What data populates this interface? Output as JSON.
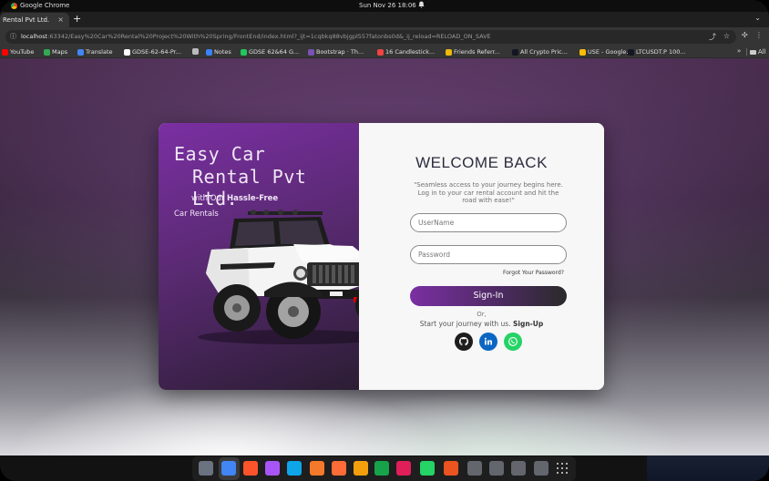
{
  "system": {
    "app_name": "Google Chrome",
    "clock": "Sun Nov 26  18:06",
    "bell_icon": "bell-icon"
  },
  "browser": {
    "tab_title": "Rental Pvt Ltd.",
    "tab_close": "×",
    "new_tab": "+",
    "tab_menu": "⌄",
    "url_host": "localhost",
    "url_path": ":63342/Easy%20Car%20Rental%20Project%20With%20Spring/FrontEnd/index.html?_ijt=1cqbkq88vbjgpl557fatonbs0d&_ij_reload=RELOAD_ON_SAVE",
    "bookmarks": [
      {
        "label": "YouTube",
        "color": "#ff0000"
      },
      {
        "label": "Maps",
        "color": "#34a853"
      },
      {
        "label": "Translate",
        "color": "#4285f4"
      },
      {
        "label": "GDSE-62-64-Pr...",
        "color": "#ffffff"
      },
      {
        "label": "",
        "color": "#bbbbbb"
      },
      {
        "label": "Notes",
        "color": "#3b82f6"
      },
      {
        "label": "GDSE 62&64 G...",
        "color": "#22c55e"
      },
      {
        "label": "Bootstrap · Th...",
        "color": "#7952b3"
      },
      {
        "label": "16 Candlestick...",
        "color": "#ef4444"
      },
      {
        "label": "Friends Referr...",
        "color": "#f0b90b"
      },
      {
        "label": "All Crypto Pric...",
        "color": "#131722"
      },
      {
        "label": "USE - Google...",
        "color": "#fbbc05"
      },
      {
        "label": "LTCUSDT.P 100...",
        "color": "#131722"
      }
    ],
    "bookmarks_more": "»",
    "all_bookmarks": "All"
  },
  "hero": {
    "brand_line1": "Easy Car",
    "brand_line2": "Rental Pvt Ltd.",
    "tagline_prefix": "with Our",
    "tagline_bold": "Hassle-Free",
    "tagline_line2": "Car Rentals"
  },
  "login": {
    "title": "WELCOME BACK",
    "description": "\"Seamless access to your journey begins here. Log in to your car rental account and hit the road with ease!\"",
    "username_placeholder": "UserName",
    "password_placeholder": "Password",
    "forgot_password": "Forgot Your Password?",
    "signin_label": "Sign-In",
    "or_text": "Or,",
    "journey_text": "Start your journey with us.",
    "signup_label": "Sign-Up",
    "social": [
      {
        "name": "github-icon",
        "color": "#1d1d1d"
      },
      {
        "name": "linkedin-icon",
        "color": "#0a66c2"
      },
      {
        "name": "whatsapp-icon",
        "color": "#25d366"
      }
    ]
  },
  "dock": {
    "apps": [
      {
        "name": "files-icon",
        "color": "#6b7280"
      },
      {
        "name": "chrome-icon",
        "color": "#4285f4"
      },
      {
        "name": "brave-icon",
        "color": "#fb542b"
      },
      {
        "name": "intellij-icon",
        "color": "#a855f7"
      },
      {
        "name": "vscode-icon",
        "color": "#0ea5e9"
      },
      {
        "name": "blender-icon",
        "color": "#f5792a"
      },
      {
        "name": "postman-icon",
        "color": "#ff6c37"
      },
      {
        "name": "sublime-icon",
        "color": "#f59e0b"
      },
      {
        "name": "git-icon",
        "color": "#16a34a"
      },
      {
        "name": "slack-icon",
        "color": "#e01e5a"
      },
      {
        "name": "whatsapp-app-icon",
        "color": "#25d366"
      },
      {
        "name": "software-center-icon",
        "color": "#e95420"
      },
      {
        "name": "window-1-icon",
        "color": "#9ca3af"
      },
      {
        "name": "window-2-icon",
        "color": "#9ca3af"
      },
      {
        "name": "window-3-icon",
        "color": "#9ca3af"
      },
      {
        "name": "trash-icon",
        "color": "#9ca3af"
      }
    ]
  }
}
